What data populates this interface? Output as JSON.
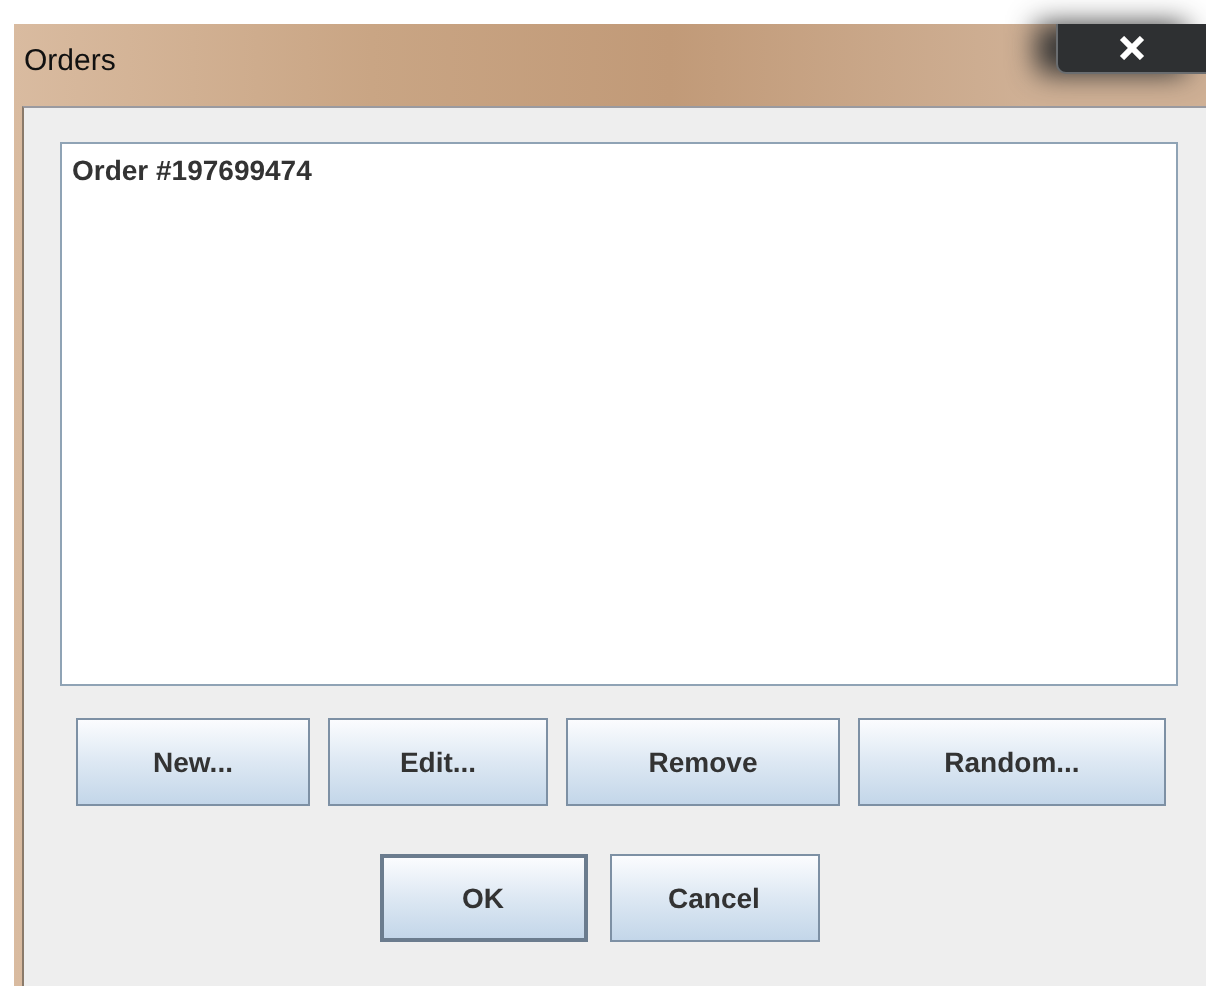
{
  "window": {
    "title": "Orders"
  },
  "list": {
    "items": [
      {
        "label": "Order #197699474",
        "selected": false
      }
    ]
  },
  "actions": [
    {
      "label": "New...",
      "default": false
    },
    {
      "label": "Edit...",
      "default": false
    },
    {
      "label": "Remove",
      "default": false
    },
    {
      "label": "Random...",
      "default": false
    }
  ],
  "buttons": [
    {
      "label": "OK",
      "default": true
    },
    {
      "label": "Cancel",
      "default": false
    }
  ]
}
